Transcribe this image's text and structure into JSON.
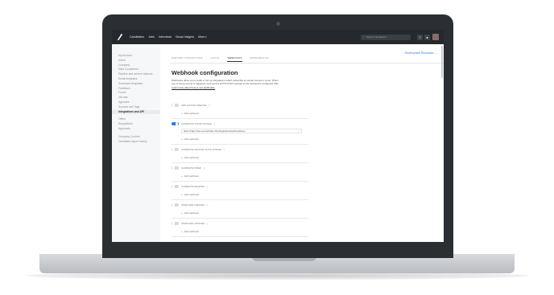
{
  "topbar": {
    "nav": [
      "Candidates",
      "Jobs",
      "Interviews",
      "Visual Insights",
      "More"
    ],
    "search_placeholder": "Search candidates",
    "icons": [
      "logo-icon",
      "search-icon",
      "help-icon",
      "bell-icon",
      "avatar"
    ]
  },
  "sidebar": {
    "group1": [
      "My Account",
      "Users",
      "Company",
      "Data Compliance",
      "Pipeline and archive reasons",
      "Email templates",
      "Scorecard templates",
      "Feedback",
      "Forms",
      "Job ads",
      "Agencies",
      "Sources and Tags",
      "Integrations and API"
    ],
    "group2": [
      "Offers",
      "Requisitions",
      "Approvals"
    ],
    "group3": [
      "Company Content",
      "Candidate import history"
    ],
    "active": "Integrations and API"
  },
  "main": {
    "tabs": [
      "PARTNER INTEGRATIONS",
      "OAUTH",
      "WEBHOOKS",
      "WORKABLE API"
    ],
    "active_tab": "WEBHOOKS",
    "dev_resources": "Development Resources →",
    "title": "Webhook configuration",
    "desc_lines": [
      "Webhooks allow you to build or set up integrations which subscribe to certain events in",
      "Lever. When one of those events is triggered, we'll send a HTTP POST payload to the",
      "webhook's configured URL."
    ],
    "desc_link": "Learn more about how to use webhooks.",
    "add_label": "Add webhook",
    "hooks": [
      {
        "name": "APPLICATION CREATED",
        "on": false,
        "url": ""
      },
      {
        "name": "CANDIDATE STAGE CHANGE",
        "on": true,
        "url": "https://https://test.sourcefinder.info/integrations/webhook/lever"
      },
      {
        "name": "CANDIDATE ARCHIVE STATE CHANGE",
        "on": false,
        "url": ""
      },
      {
        "name": "CANDIDATE HIRED",
        "on": false,
        "url": ""
      },
      {
        "name": "CANDIDATE DELETED",
        "on": false,
        "url": ""
      },
      {
        "name": "INTERVIEW CREATED",
        "on": false,
        "url": ""
      },
      {
        "name": "INTERVIEW UPDATED",
        "on": false,
        "url": ""
      }
    ]
  }
}
